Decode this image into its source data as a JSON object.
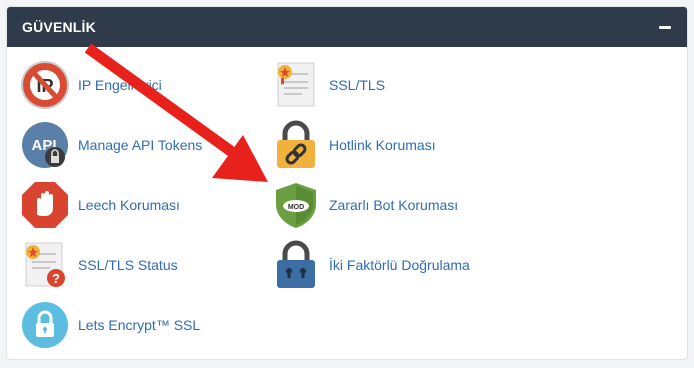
{
  "panel": {
    "title": "GÜVENLİK",
    "collapse_icon": "minus-icon"
  },
  "items": [
    {
      "label": "IP Engelleyici",
      "icon": "ip-blocker-icon"
    },
    {
      "label": "Manage API Tokens",
      "icon": "api-token-icon"
    },
    {
      "label": "Leech Koruması",
      "icon": "leech-protection-icon"
    },
    {
      "label": "SSL/TLS Status",
      "icon": "ssl-status-icon"
    },
    {
      "label": "Lets Encrypt™ SSL",
      "icon": "lets-encrypt-icon"
    },
    {
      "label": "SSL/TLS",
      "icon": "ssl-certificate-icon"
    },
    {
      "label": "Hotlink Koruması",
      "icon": "hotlink-lock-icon"
    },
    {
      "label": "Zararlı Bot Koruması",
      "icon": "mod-shield-icon"
    },
    {
      "label": "İki Faktörlü Doğrulama",
      "icon": "two-factor-lock-icon"
    }
  ],
  "colors": {
    "header_bg": "#2f3b4a",
    "link": "#2f6db5",
    "annotation_arrow": "#e8211d"
  }
}
